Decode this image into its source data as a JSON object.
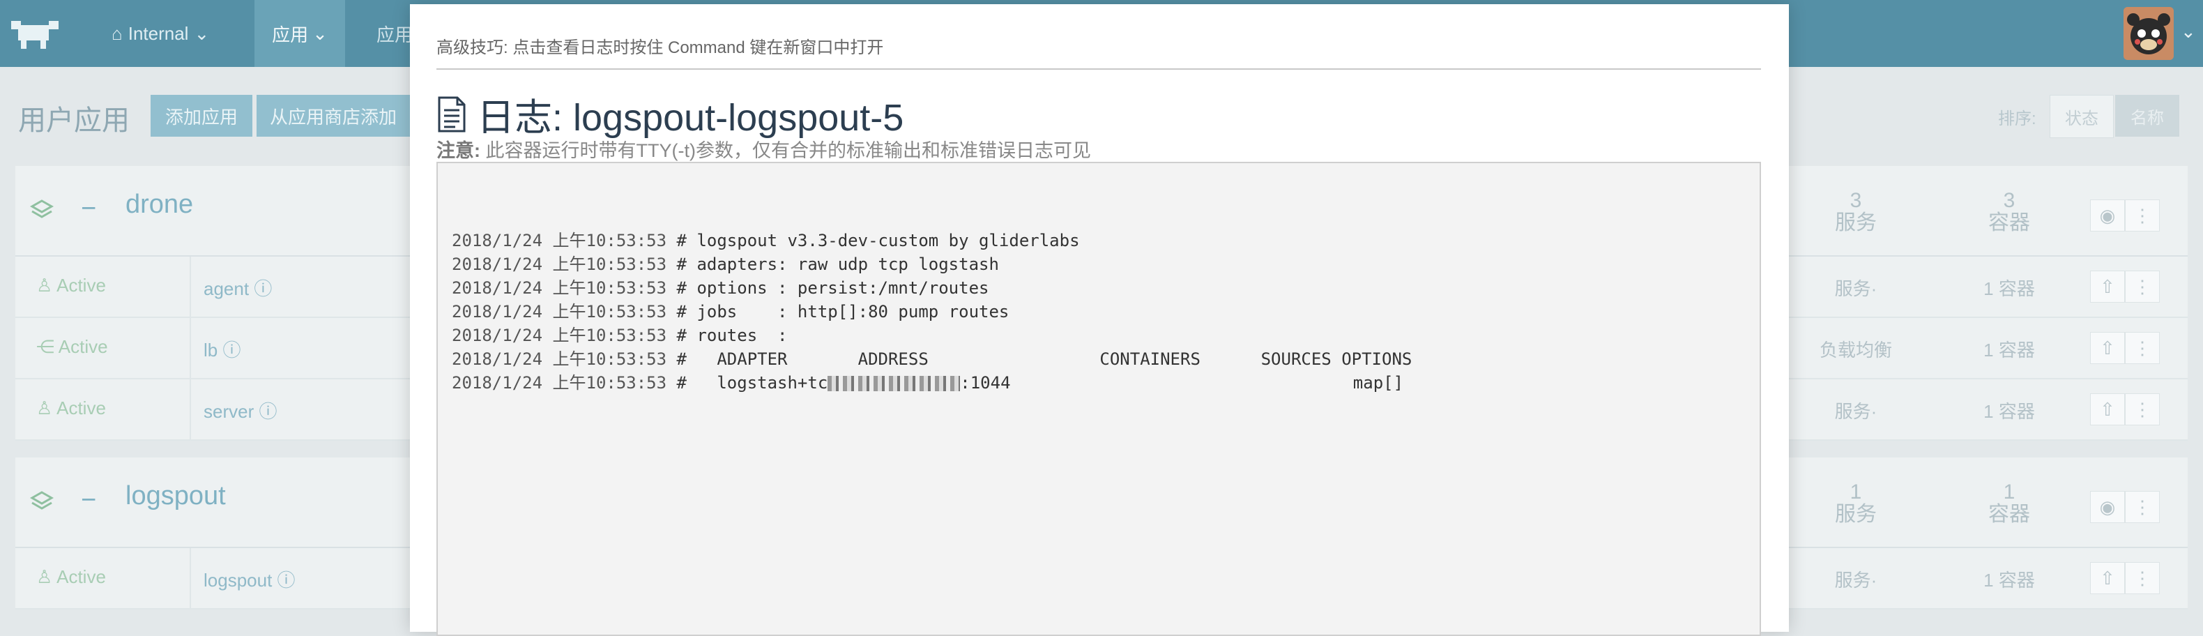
{
  "header": {
    "environment_label": "Internal",
    "apps_label": "应用",
    "more_label": "应用"
  },
  "page": {
    "title": "用户应用",
    "add_app_label": "添加应用",
    "add_from_store_label": "从应用商店添加",
    "sort_label": "排序:",
    "sort_state_label": "状态",
    "sort_name_label": "名称"
  },
  "stacks": [
    {
      "name": "drone",
      "services_count": "3",
      "services_label": "服务",
      "containers_count": "3",
      "containers_label": "容器",
      "rows": [
        {
          "state": "Active",
          "name": "agent",
          "kind": "服务·",
          "count": "1 容器"
        },
        {
          "state": "Active",
          "name": "lb",
          "kind": "负载均衡",
          "count": "1 容器"
        },
        {
          "state": "Active",
          "name": "server",
          "kind": "服务·",
          "count": "1 容器"
        }
      ]
    },
    {
      "name": "logspout",
      "services_count": "1",
      "services_label": "服务",
      "containers_count": "1",
      "containers_label": "容器",
      "rows": [
        {
          "state": "Active",
          "name": "logspout",
          "kind": "服务·",
          "count": "1 容器"
        }
      ]
    }
  ],
  "modal": {
    "tip": "高级技巧: 点击查看日志时按住 Command 键在新窗口中打开",
    "title": "日志: logspout-logspout-5",
    "note_label": "注意:",
    "note_text": " 此容器运行时带有TTY(-t)参数，仅有合并的标准输出和标准错误日志可见",
    "log_lines": [
      {
        "ts": "2018/1/24 上午10:53:53",
        "msg": " # logspout v3.3-dev-custom by gliderlabs"
      },
      {
        "ts": "2018/1/24 上午10:53:53",
        "msg": " # adapters: raw udp tcp logstash"
      },
      {
        "ts": "2018/1/24 上午10:53:53",
        "msg": " # options : persist:/mnt/routes"
      },
      {
        "ts": "2018/1/24 上午10:53:53",
        "msg": " # jobs    : http[]:80 pump routes"
      },
      {
        "ts": "2018/1/24 上午10:53:53",
        "msg": " # routes  :"
      },
      {
        "ts": "2018/1/24 上午10:53:53",
        "msg": " #   ADAPTER       ADDRESS                 CONTAINERS      SOURCES OPTIONS"
      },
      {
        "ts": "2018/1/24 上午10:53:53",
        "msg_pre": " #   logstash+tc",
        "msg_post": ":1044                                  map[]"
      }
    ]
  },
  "colors": {
    "topbar": "#5590a6",
    "accent": "#92bfcf",
    "modal_bg": "#ffffff",
    "log_bg": "#f3f3f3"
  }
}
